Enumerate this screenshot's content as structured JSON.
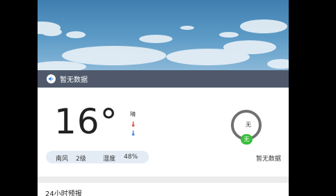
{
  "audio_bar": {
    "text": "暂无数据",
    "icon": "speaker-icon"
  },
  "weather": {
    "temperature": "16°",
    "condition": "晴",
    "wind_direction": "南风",
    "wind_level": "2级",
    "humidity_label": "湿度",
    "humidity_value": "48%"
  },
  "aqi": {
    "ring_label": "无",
    "badge": "无",
    "caption": "暂无数据",
    "ring_color": "#707070",
    "badge_color": "#3cbf3c"
  },
  "forecast": {
    "title": "24小时预报"
  },
  "colors": {
    "audio_bar_bg": "#4f596b",
    "pill_bg": "#e3ecf5",
    "thermo_red": "#e05555",
    "thermo_blue": "#4a90e2"
  }
}
